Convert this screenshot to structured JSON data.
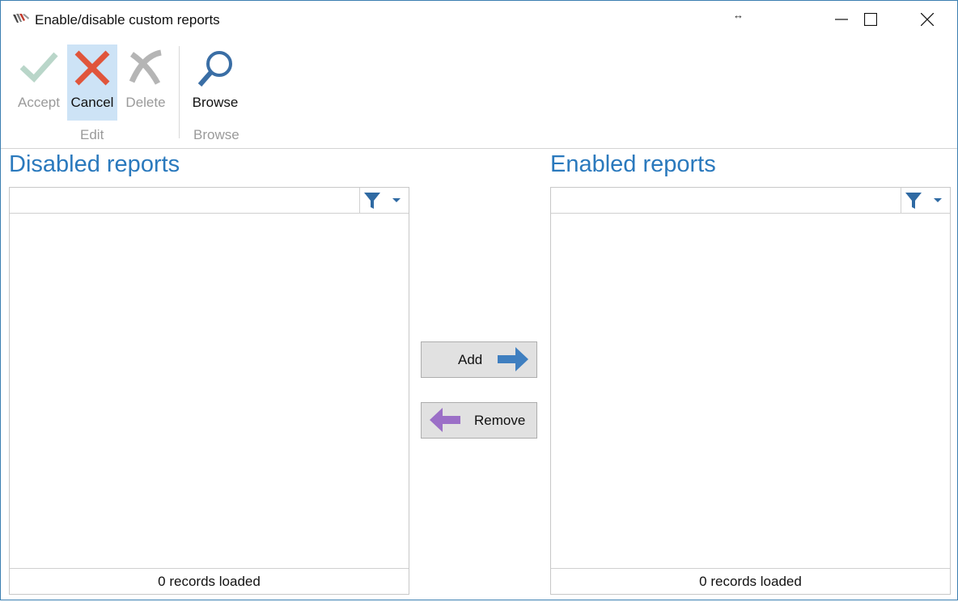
{
  "window": {
    "title": "Enable/disable custom reports",
    "resize_glyph": "↔"
  },
  "ribbon": {
    "edit_group_label": "Edit",
    "browse_group_label": "Browse",
    "buttons": {
      "accept": "Accept",
      "cancel": "Cancel",
      "delete": "Delete",
      "browse": "Browse"
    }
  },
  "left_panel": {
    "title": "Disabled reports",
    "footer": "0 records loaded"
  },
  "right_panel": {
    "title": "Enabled reports",
    "footer": "0 records loaded"
  },
  "transfer": {
    "add_label": "Add",
    "remove_label": "Remove"
  },
  "colors": {
    "accent": "#2a79bd",
    "cancel_red": "#e0553b",
    "accept_disabled": "#b9d6c9",
    "remove_purple": "#9b6fc7",
    "add_blue": "#3f7fc0"
  }
}
